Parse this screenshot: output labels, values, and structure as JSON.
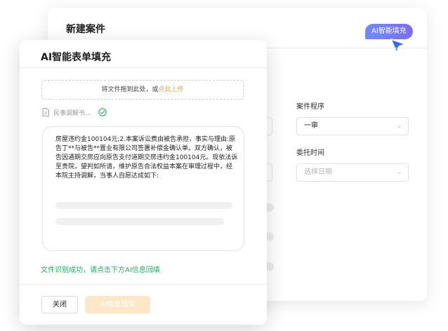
{
  "background_form": {
    "title": "新建案件",
    "ai_fill_button": "AI智能填充",
    "fields": {
      "procedure_label": "案件程序",
      "procedure_value": "一审",
      "entrust_time_label": "委托时间",
      "entrust_time_placeholder": "选择日期"
    }
  },
  "modal": {
    "title": "AI智能表单填充",
    "upload": {
      "prompt": "将文件拖到此处，或",
      "link": "点此上传"
    },
    "file": {
      "name": "民事调解书..."
    },
    "extracted_text": "房屋违约金100104元;2.本案诉讼费由被告承担，事实与理由:原告丁**与被告**置业有限公司签署补偿金确认单。双方确认，被告因通期交房应向原告支付道期交房违约金100104元。现依法诉至贵院，望判如所请，维护原告合法权益本案在审理过程中，经本院主持调解，当事人自愿达成如下:",
    "success_message": "文件识别成功，请点击下方AI信息回填",
    "buttons": {
      "close": "关闭",
      "ai_backfill": "AI信息回填"
    }
  },
  "colors": {
    "accent_gradient_start": "#6f8bff",
    "accent_gradient_end": "#7b6cf2",
    "cursor": "#2f6bff",
    "upload_link": "#f0a33a",
    "success": "#22b35e",
    "disabled_button": "#fde7c8"
  },
  "icons": {
    "cursor": "cursor-arrow-icon",
    "file": "document-icon",
    "status": "check-circle-icon",
    "select_arrow": "chevron-down-icon"
  }
}
